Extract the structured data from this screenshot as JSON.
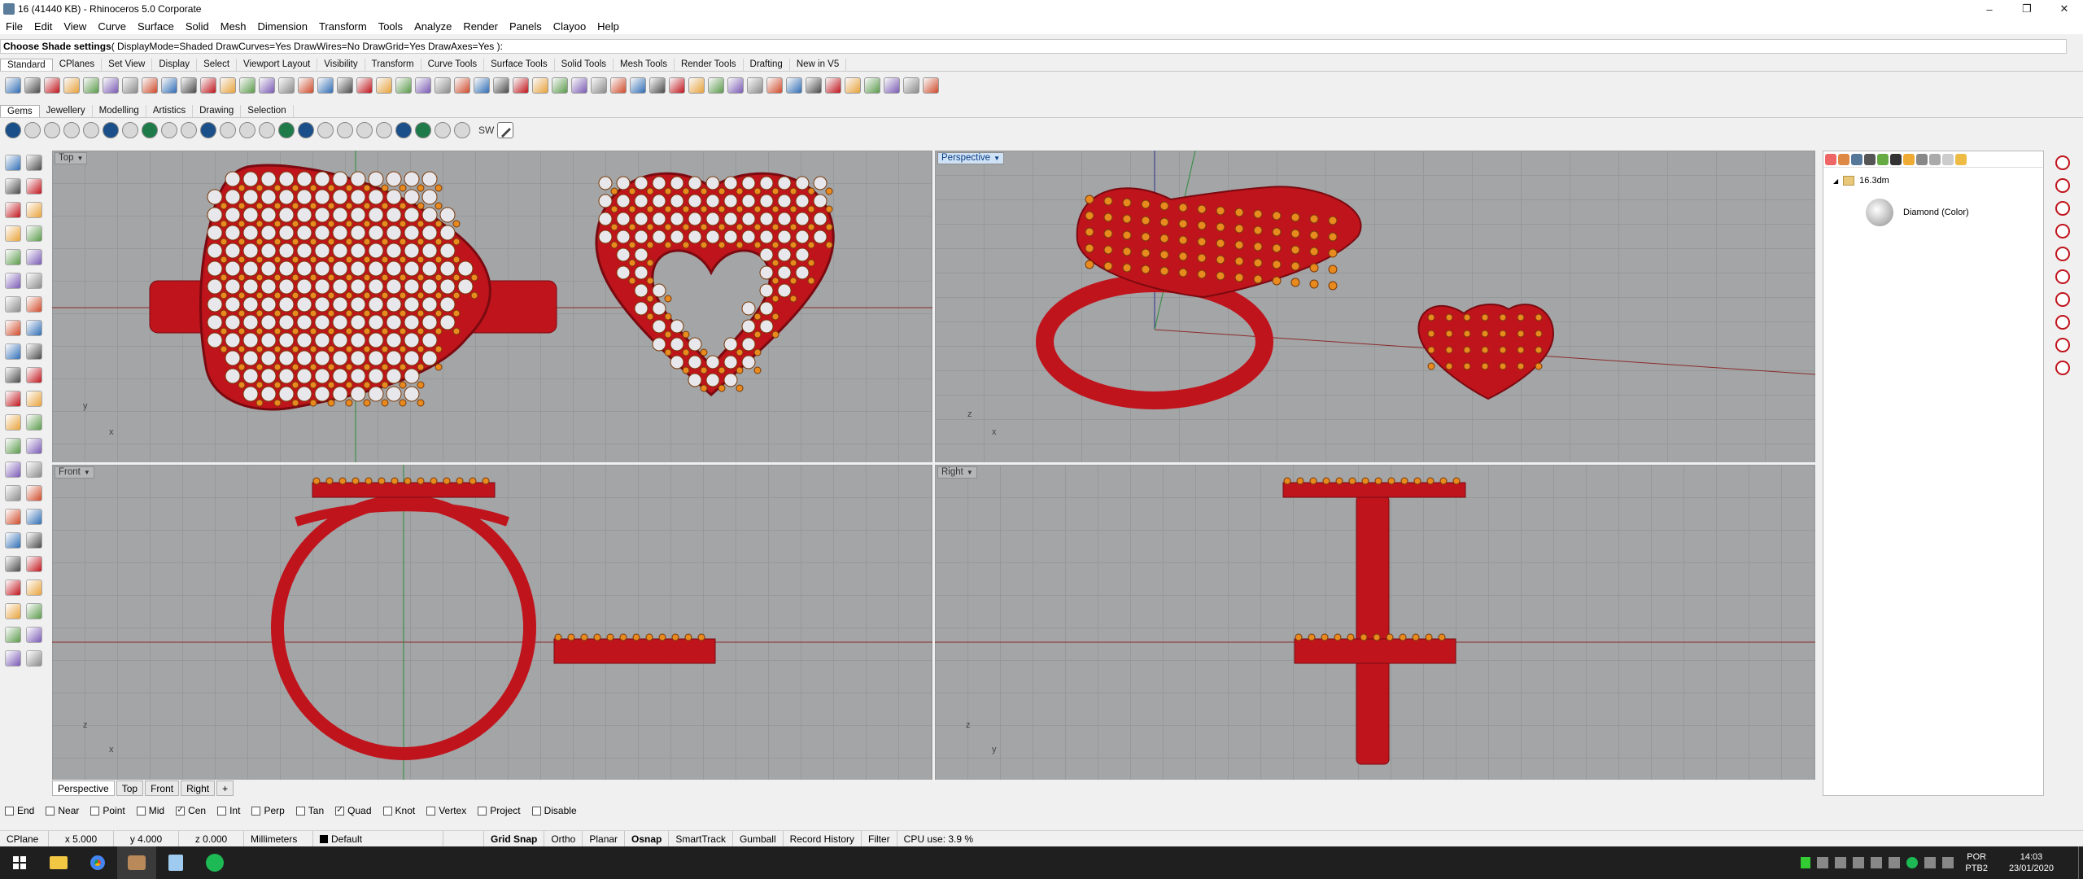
{
  "window": {
    "title": "16 (41440 KB) - Rhinoceros  5.0 Corporate",
    "controls": [
      "–",
      "❐",
      "✕"
    ]
  },
  "menu": [
    "File",
    "Edit",
    "View",
    "Curve",
    "Surface",
    "Solid",
    "Mesh",
    "Dimension",
    "Transform",
    "Tools",
    "Analyze",
    "Render",
    "Panels",
    "Clayoo",
    "Help"
  ],
  "command": {
    "prompt": "Choose Shade settings",
    "options": " ( DisplayMode=Shaded  DrawCurves=Yes  DrawWires=No  DrawGrid=Yes  DrawAxes=Yes ):"
  },
  "toolbar_tabs": [
    "Standard",
    "CPlanes",
    "Set View",
    "Display",
    "Select",
    "Viewport Layout",
    "Visibility",
    "Transform",
    "Curve Tools",
    "Surface Tools",
    "Solid Tools",
    "Mesh Tools",
    "Render Tools",
    "Drafting",
    "New in V5"
  ],
  "plugin_tabs": [
    "Gems",
    "Jewellery",
    "Modelling",
    "Artistics",
    "Drawing",
    "Selection"
  ],
  "plugin_text_button": "SW",
  "viewports": {
    "top": "Top",
    "perspective": "Perspective",
    "front": "Front",
    "right": "Right"
  },
  "axis_labels": {
    "top": [
      "y",
      "x"
    ],
    "perspective": [
      "z",
      "x"
    ],
    "front": [
      "z",
      "x"
    ],
    "right": [
      "z",
      "y"
    ]
  },
  "view_tabs": [
    "Perspective",
    "Top",
    "Front",
    "Right"
  ],
  "osnaps": [
    {
      "label": "End",
      "checked": false
    },
    {
      "label": "Near",
      "checked": false
    },
    {
      "label": "Point",
      "checked": false
    },
    {
      "label": "Mid",
      "checked": false
    },
    {
      "label": "Cen",
      "checked": true
    },
    {
      "label": "Int",
      "checked": false
    },
    {
      "label": "Perp",
      "checked": false
    },
    {
      "label": "Tan",
      "checked": false
    },
    {
      "label": "Quad",
      "checked": true
    },
    {
      "label": "Knot",
      "checked": false
    },
    {
      "label": "Vertex",
      "checked": false
    },
    {
      "label": "Project",
      "checked": false
    },
    {
      "label": "Disable",
      "checked": false
    }
  ],
  "status": {
    "cplane": "CPlane",
    "x": "x 5.000",
    "y": "y 4.000",
    "z": "z 0.000",
    "units": "Millimeters",
    "layer": "Default",
    "toggles": [
      "Grid Snap",
      "Ortho",
      "Planar",
      "Osnap",
      "SmartTrack",
      "Gumball",
      "Record History",
      "Filter"
    ],
    "cpu": "CPU use: 3.9 %"
  },
  "panel": {
    "file": "16.3dm",
    "material": "Diamond (Color)"
  },
  "taskbar": {
    "lang": "POR",
    "lang2": "PTB2",
    "time": "14:03",
    "date": "23/01/2020"
  },
  "colors": {
    "viewport_bg": "#a3a5a7",
    "metal": "#c0141c",
    "gem_orange": "#e88a1e",
    "gem_white": "#e8e8ec",
    "active_label": "#cfe1f5"
  }
}
